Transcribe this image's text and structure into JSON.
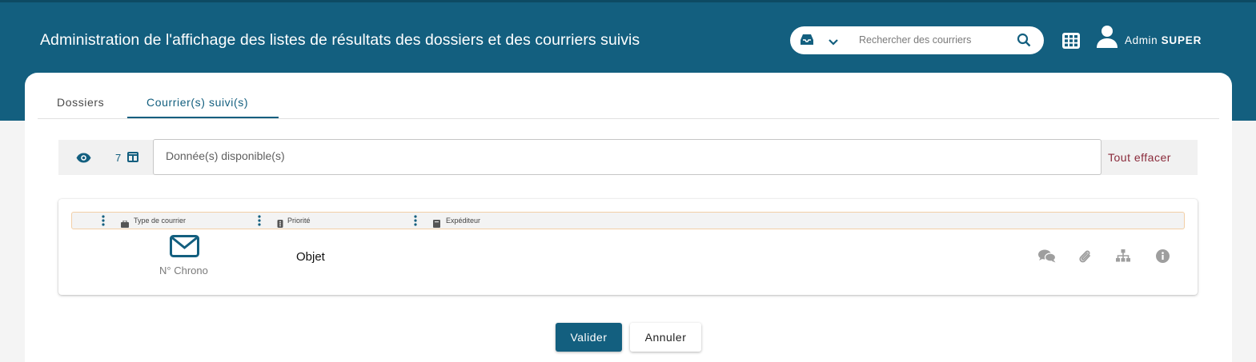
{
  "header": {
    "title": "Administration de l'affichage des listes de résultats des dossiers et des courriers suivis",
    "search": {
      "placeholder": "Rechercher des courriers"
    },
    "user": {
      "first_name": "Admin",
      "last_name": "SUPER"
    },
    "icons": [
      "inbox-icon",
      "chevron-down-icon",
      "search-icon",
      "apps-grid-icon",
      "user-icon"
    ]
  },
  "tabs": [
    {
      "label": "Dossiers",
      "active": false
    },
    {
      "label": "Courrier(s) suivi(s)",
      "active": true
    }
  ],
  "toolbar": {
    "count": "7",
    "field_placeholder": "Donnée(s) disponible(s)",
    "clear_label": "Tout effacer",
    "icons": [
      "eye-icon",
      "columns-icon"
    ]
  },
  "preview": {
    "columns": [
      {
        "label": "Type de courrier",
        "icon": "briefcase-icon"
      },
      {
        "label": "Priorité",
        "icon": "priority-icon"
      },
      {
        "label": "Expéditeur",
        "icon": "address-book-icon"
      }
    ],
    "chrono_label": "N° Chrono",
    "object_label": "Objet",
    "actions": [
      "comments-icon",
      "paperclip-icon",
      "sitemap-icon",
      "info-icon"
    ]
  },
  "buttons": {
    "validate": "Valider",
    "cancel": "Annuler"
  },
  "colors": {
    "primary": "#135f7f",
    "danger_text": "#8a2a3a",
    "column_border": "#f2cfa6",
    "icon_grey": "#9e9e9e"
  }
}
